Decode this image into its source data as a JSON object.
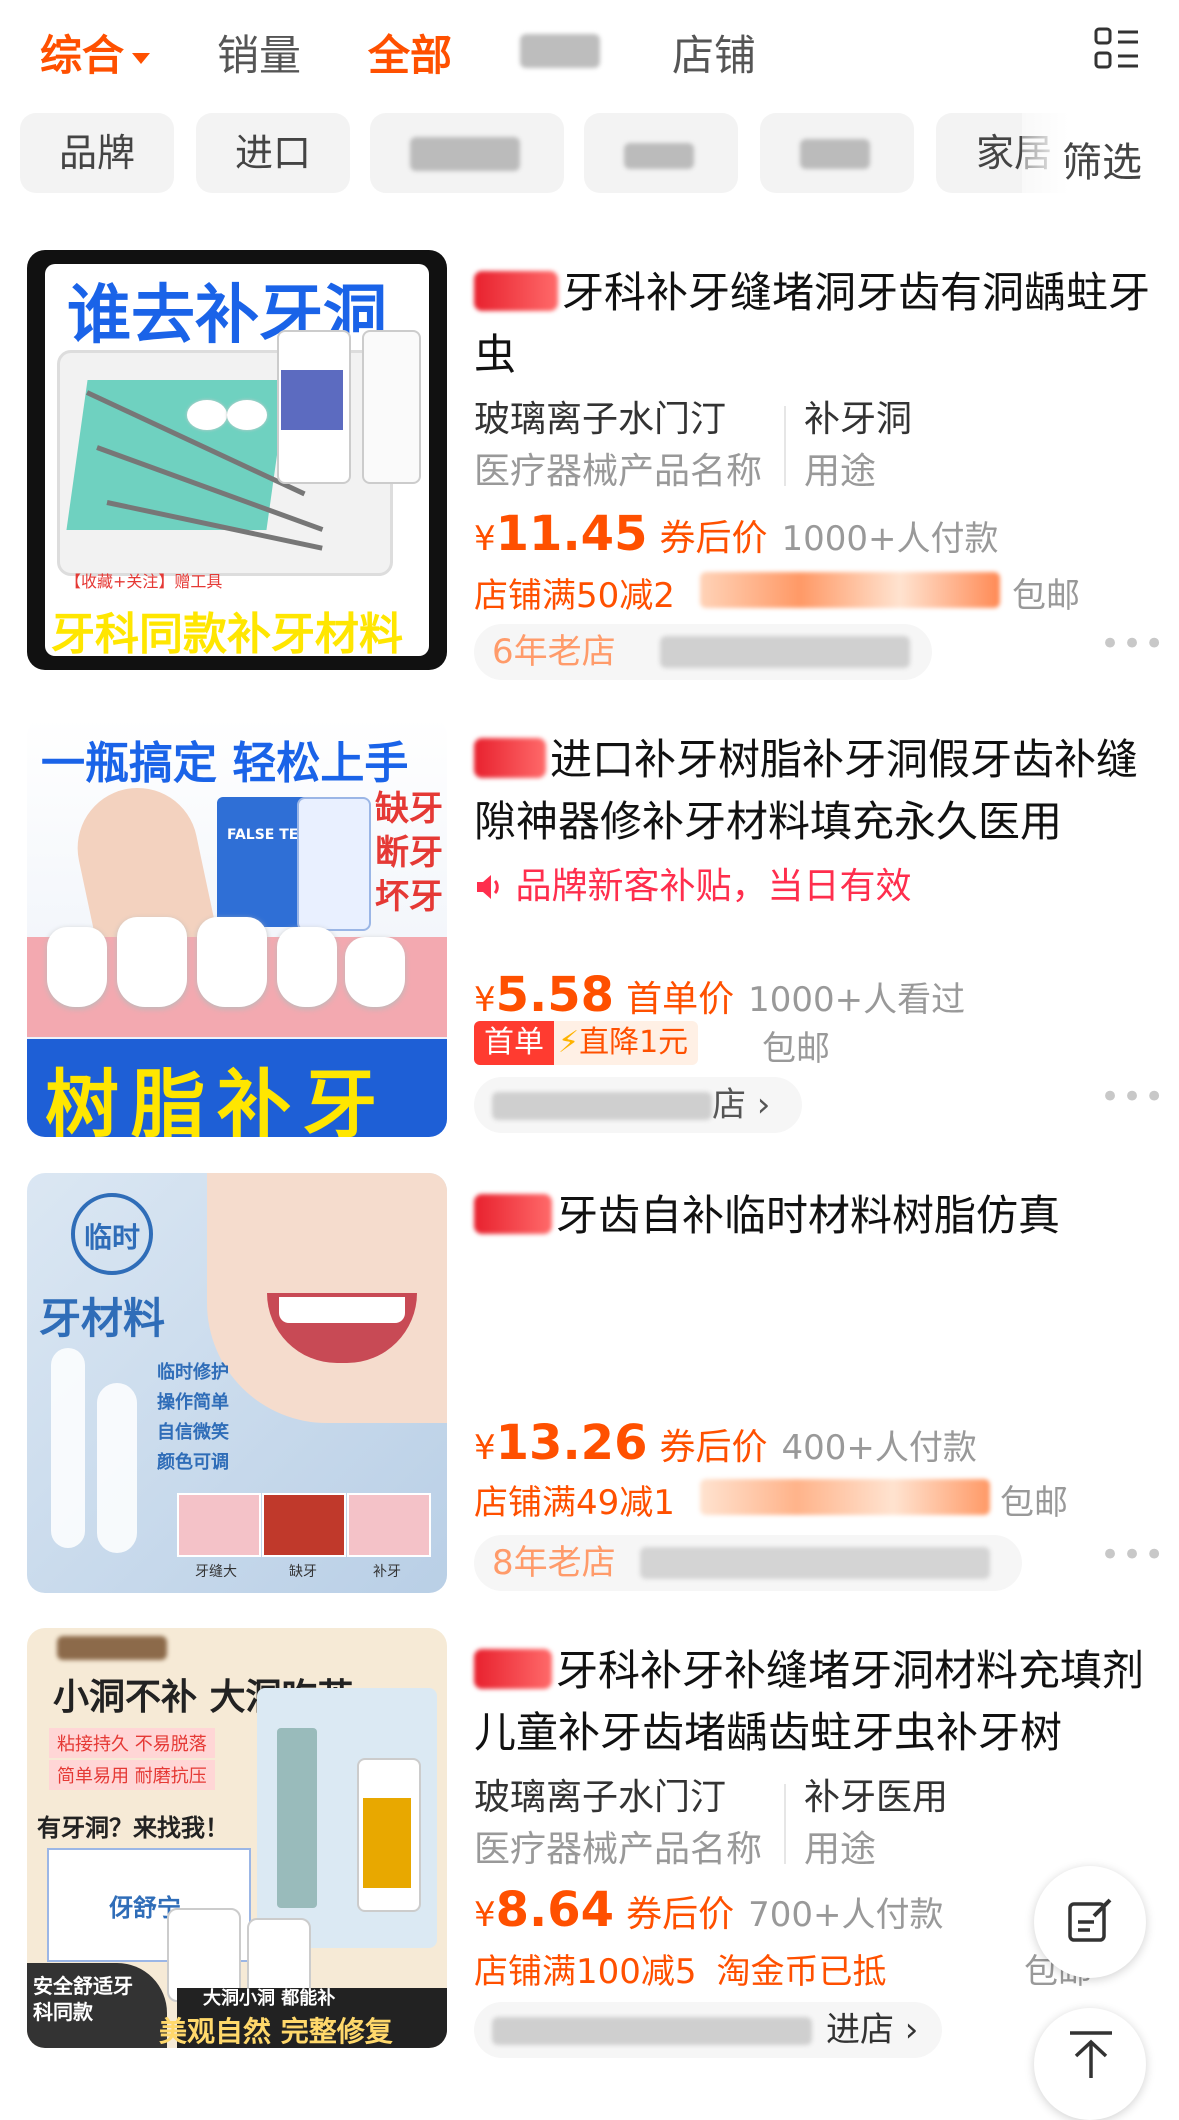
{
  "sort_bar": {
    "items": [
      "综合",
      "销量",
      "全部",
      "店铺"
    ]
  },
  "filters": {
    "chips": [
      "品牌",
      "进口",
      "家居"
    ],
    "filter_label": "筛选"
  },
  "products": [
    {
      "title": "牙科补牙缝堵洞牙齿有洞龋蛀牙虫",
      "attr1_value": "玻璃离子水门汀",
      "attr1_key": "医疗器械产品名称",
      "attr2_value": "补牙洞",
      "attr2_key": "用途",
      "price_symbol": "¥",
      "price": "11.45",
      "price_label": "券后价",
      "sold": "1000+人付款",
      "promo": "店铺满50减2",
      "shipping": "包邮",
      "store": "6年老店",
      "thumb": {
        "headline": "谁去补牙洞",
        "footer": "牙科同款补牙材料",
        "note": "【收藏+关注】赠工具"
      }
    },
    {
      "title": "进口补牙树脂补牙洞假牙齿补缝隙神器修补牙材料填充永久医用",
      "subsidy": "品牌新客补贴，当日有效",
      "price_symbol": "¥",
      "price": "5.58",
      "price_label": "首单价",
      "sold": "1000+人看过",
      "badge_a": "首单",
      "badge_b": "直降1元",
      "shipping": "包邮",
      "store": "店",
      "thumb": {
        "headline": "一瓶搞定 轻松上手",
        "side": [
          "缺牙",
          "断牙",
          "坏牙"
        ],
        "footer": "树脂补牙",
        "bottle_label": "FALSE TEETH"
      }
    },
    {
      "title": "牙齿自补临时材料树脂仿真",
      "price_symbol": "¥",
      "price": "13.26",
      "price_label": "券后价",
      "sold": "400+人付款",
      "promo": "店铺满49减1",
      "shipping": "包邮",
      "store": "8年老店",
      "thumb": {
        "badge": "临时",
        "headline": "牙材料",
        "bullets": [
          "临时修护",
          "操作简单",
          "自信微笑",
          "颜色可调"
        ],
        "captions": [
          "牙缝大",
          "缺牙",
          "补牙"
        ]
      }
    },
    {
      "title": "牙科补牙补缝堵牙洞材料充填剂儿童补牙齿堵龋齿蛀牙虫补牙树",
      "attr1_value": "玻璃离子水门汀",
      "attr1_key": "医疗器械产品名称",
      "attr2_value": "补牙医用",
      "attr2_key": "用途",
      "price_symbol": "¥",
      "price": "8.64",
      "price_label": "券后价",
      "sold": "700+人付款",
      "promo": "店铺满100减5",
      "promo_extra": "淘金币已抵",
      "shipping": "包邮",
      "store": "进店",
      "thumb": {
        "headline": "小洞不补 大洞吃苦",
        "tags": [
          "粘接持久 不易脱落",
          "简单易用 耐磨抗压"
        ],
        "ask": "有牙洞？来找我！",
        "brand": "伢舒宁",
        "corner": "安全舒适牙科同款",
        "slogan_top": "大洞小洞 都能补",
        "slogan": "美观自然 完整修复"
      }
    }
  ],
  "colors": {
    "accent": "#ff5000",
    "subsidy": "#ff2e4d",
    "muted": "#999999"
  }
}
